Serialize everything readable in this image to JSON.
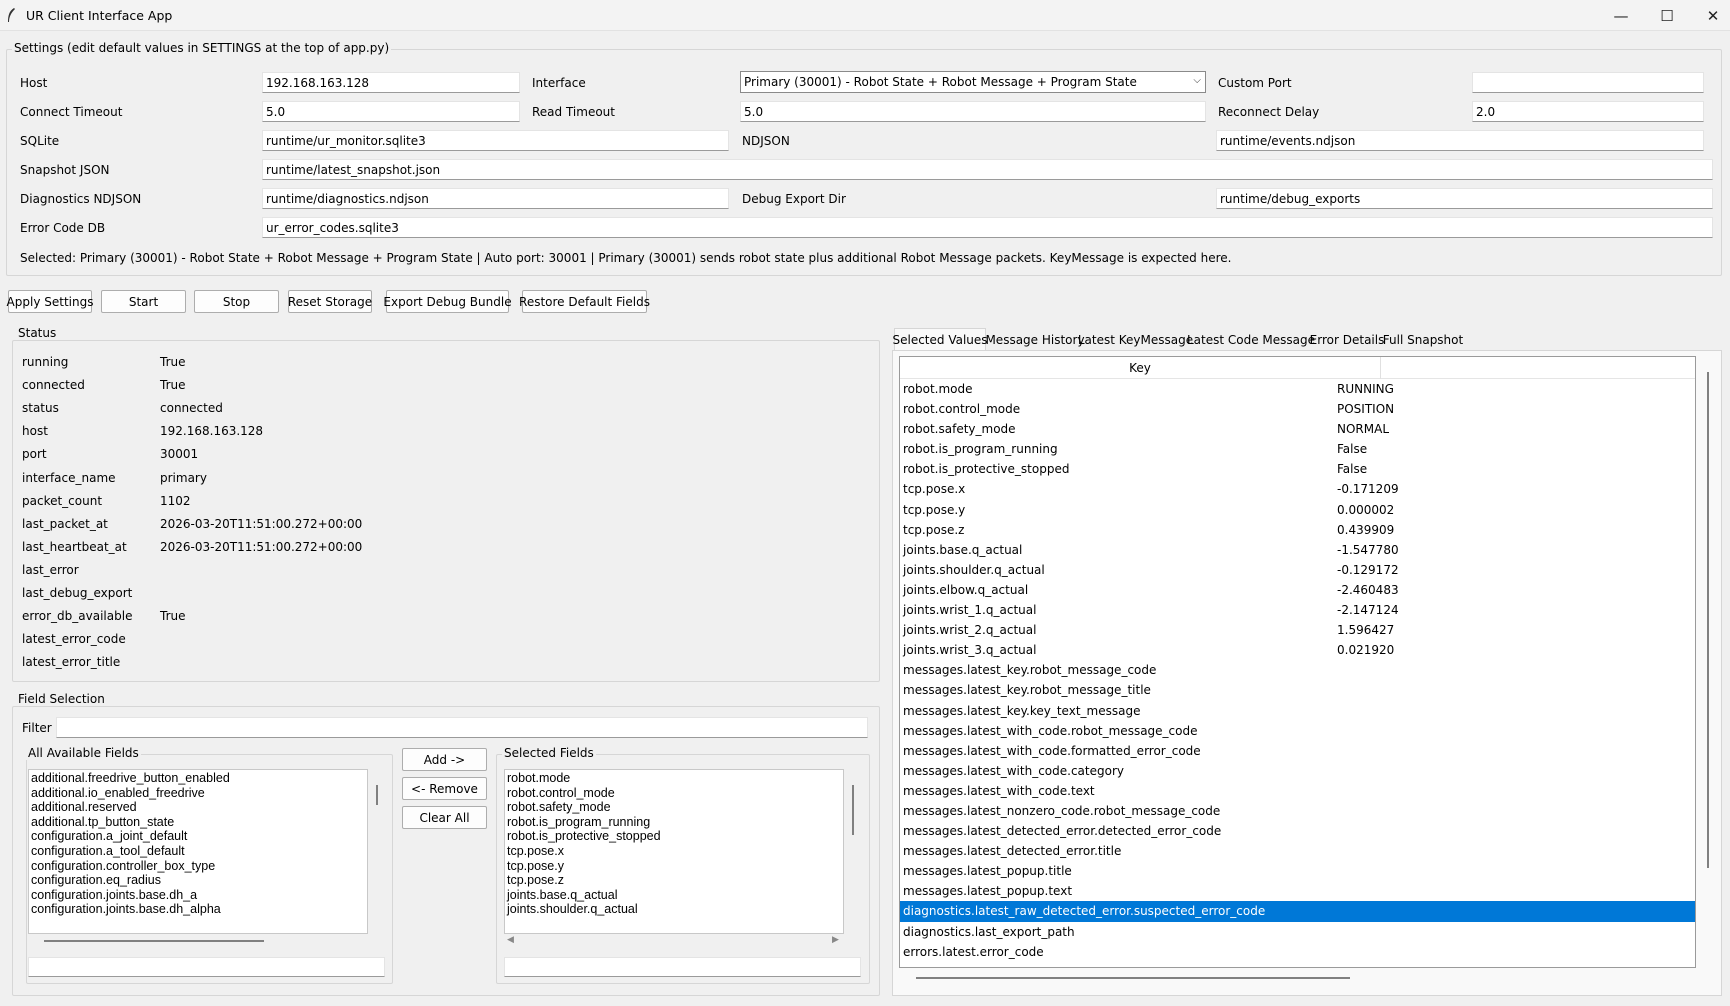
{
  "window": {
    "title": "UR Client Interface App",
    "minimize_glyph": "—",
    "maximize_glyph": "☐",
    "close_glyph": "✕"
  },
  "settings": {
    "group_label": "Settings (edit default values in SETTINGS at the top of app.py)",
    "host_label": "Host",
    "host_value": "192.168.163.128",
    "interface_label": "Interface",
    "interface_value": "Primary (30001) - Robot State + Robot Message + Program State",
    "custom_port_label": "Custom Port",
    "custom_port_value": "",
    "connect_timeout_label": "Connect Timeout",
    "connect_timeout_value": "5.0",
    "read_timeout_label": "Read Timeout",
    "read_timeout_value": "5.0",
    "reconnect_delay_label": "Reconnect Delay",
    "reconnect_delay_value": "2.0",
    "sqlite_label": "SQLite",
    "sqlite_value": "runtime/ur_monitor.sqlite3",
    "ndjson_label": "NDJSON",
    "ndjson_value": "runtime/events.ndjson",
    "snapshot_label": "Snapshot JSON",
    "snapshot_value": "runtime/latest_snapshot.json",
    "diag_label": "Diagnostics NDJSON",
    "diag_value": "runtime/diagnostics.ndjson",
    "debug_dir_label": "Debug Export Dir",
    "debug_dir_value": "runtime/debug_exports",
    "error_db_label": "Error Code DB",
    "error_db_value": "ur_error_codes.sqlite3",
    "selected_info": "Selected: Primary (30001) - Robot State + Robot Message + Program State | Auto port: 30001 | Primary (30001) sends robot state plus additional Robot Message packets. KeyMessage is expected here."
  },
  "toolbar": {
    "apply": "Apply Settings",
    "start": "Start",
    "stop": "Stop",
    "reset": "Reset Storage",
    "export": "Export Debug Bundle",
    "restore": "Restore Default Fields"
  },
  "status": {
    "group_label": "Status",
    "rows": [
      {
        "key": "running",
        "value": "True"
      },
      {
        "key": "connected",
        "value": "True"
      },
      {
        "key": "status",
        "value": "connected"
      },
      {
        "key": "host",
        "value": "192.168.163.128"
      },
      {
        "key": "port",
        "value": "30001"
      },
      {
        "key": "interface_name",
        "value": "primary"
      },
      {
        "key": "packet_count",
        "value": "1102"
      },
      {
        "key": "last_packet_at",
        "value": "2026-03-20T11:51:00.272+00:00"
      },
      {
        "key": "last_heartbeat_at",
        "value": "2026-03-20T11:51:00.272+00:00"
      },
      {
        "key": "last_error",
        "value": ""
      },
      {
        "key": "last_debug_export",
        "value": ""
      },
      {
        "key": "error_db_available",
        "value": "True"
      },
      {
        "key": "latest_error_code",
        "value": ""
      },
      {
        "key": "latest_error_title",
        "value": ""
      }
    ]
  },
  "fields": {
    "group_label": "Field Selection",
    "filter_label": "Filter",
    "filter_value": "",
    "available_label": "All Available Fields",
    "available": [
      "additional.freedrive_button_enabled",
      "additional.io_enabled_freedrive",
      "additional.reserved",
      "additional.tp_button_state",
      "configuration.a_joint_default",
      "configuration.a_tool_default",
      "configuration.controller_box_type",
      "configuration.eq_radius",
      "configuration.joints.base.dh_a",
      "configuration.joints.base.dh_alpha"
    ],
    "add": "Add ->",
    "remove": "<- Remove",
    "clear": "Clear All",
    "selected_label": "Selected Fields",
    "selected": [
      "robot.mode",
      "robot.control_mode",
      "robot.safety_mode",
      "robot.is_program_running",
      "robot.is_protective_stopped",
      "tcp.pose.x",
      "tcp.pose.y",
      "tcp.pose.z",
      "joints.base.q_actual",
      "joints.shoulder.q_actual"
    ],
    "scroll_left": "◀",
    "scroll_right": "▶"
  },
  "tabs": [
    "Selected Values",
    "Message History",
    "Latest KeyMessage",
    "Latest Code Message",
    "Error Details",
    "Full Snapshot"
  ],
  "values_table": {
    "key_header": "Key",
    "rows": [
      {
        "key": "robot.mode",
        "value": "RUNNING"
      },
      {
        "key": "robot.control_mode",
        "value": "POSITION"
      },
      {
        "key": "robot.safety_mode",
        "value": "NORMAL"
      },
      {
        "key": "robot.is_program_running",
        "value": "False"
      },
      {
        "key": "robot.is_protective_stopped",
        "value": "False"
      },
      {
        "key": "tcp.pose.x",
        "value": "-0.171209"
      },
      {
        "key": "tcp.pose.y",
        "value": "0.000002"
      },
      {
        "key": "tcp.pose.z",
        "value": "0.439909"
      },
      {
        "key": "joints.base.q_actual",
        "value": "-1.547780"
      },
      {
        "key": "joints.shoulder.q_actual",
        "value": "-0.129172"
      },
      {
        "key": "joints.elbow.q_actual",
        "value": "-2.460483"
      },
      {
        "key": "joints.wrist_1.q_actual",
        "value": "-2.147124"
      },
      {
        "key": "joints.wrist_2.q_actual",
        "value": "1.596427"
      },
      {
        "key": "joints.wrist_3.q_actual",
        "value": "0.021920"
      },
      {
        "key": "messages.latest_key.robot_message_code",
        "value": ""
      },
      {
        "key": "messages.latest_key.robot_message_title",
        "value": ""
      },
      {
        "key": "messages.latest_key.key_text_message",
        "value": ""
      },
      {
        "key": "messages.latest_with_code.robot_message_code",
        "value": ""
      },
      {
        "key": "messages.latest_with_code.formatted_error_code",
        "value": ""
      },
      {
        "key": "messages.latest_with_code.category",
        "value": ""
      },
      {
        "key": "messages.latest_with_code.text",
        "value": ""
      },
      {
        "key": "messages.latest_nonzero_code.robot_message_code",
        "value": ""
      },
      {
        "key": "messages.latest_detected_error.detected_error_code",
        "value": ""
      },
      {
        "key": "messages.latest_detected_error.title",
        "value": ""
      },
      {
        "key": "messages.latest_popup.title",
        "value": ""
      },
      {
        "key": "messages.latest_popup.text",
        "value": ""
      },
      {
        "key": "diagnostics.latest_raw_detected_error.suspected_error_code",
        "value": "",
        "selected": true
      },
      {
        "key": "diagnostics.last_export_path",
        "value": ""
      },
      {
        "key": "errors.latest.error_code",
        "value": ""
      }
    ]
  }
}
